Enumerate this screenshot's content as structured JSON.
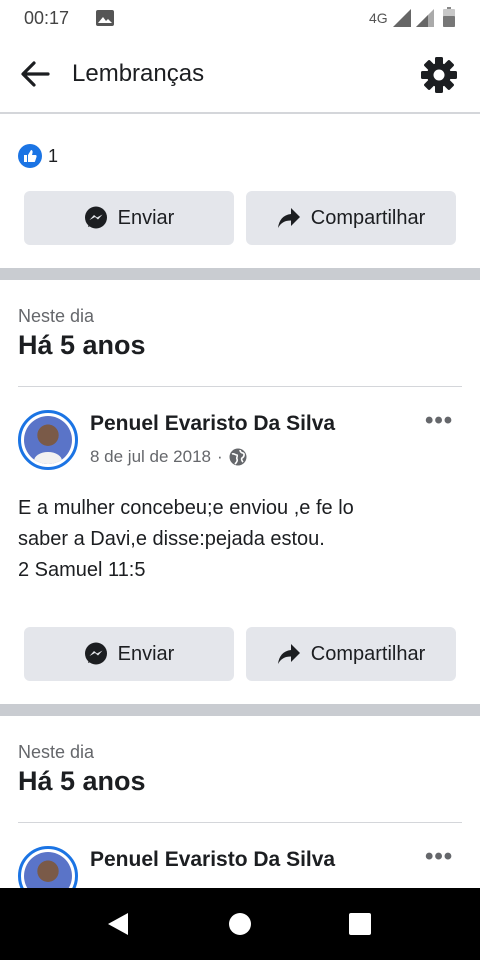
{
  "status_bar": {
    "time": "00:17",
    "network": "4G"
  },
  "app_bar": {
    "title": "Lembranças"
  },
  "memory1": {
    "reaction_count": "1",
    "send_label": "Enviar",
    "share_label": "Compartilhar"
  },
  "memory2": {
    "section_label": "Neste dia",
    "section_title": "Há 5 anos",
    "author": "Penuel Evaristo Da Silva",
    "date": "8 de jul de 2018",
    "text_lines": [
      "E a mulher concebeu;e enviou ,e fe lo",
      "saber a Davi,e disse:pejada estou.",
      "2 Samuel 11:5"
    ],
    "send_label": "Enviar",
    "share_label": "Compartilhar"
  },
  "memory3": {
    "section_label": "Neste dia",
    "section_title": "Há 5 anos",
    "author": "Penuel Evaristo Da Silva"
  },
  "colors": {
    "accent": "#1b74e4",
    "button_bg": "#e4e6eb",
    "separator": "#c9ccd1"
  }
}
